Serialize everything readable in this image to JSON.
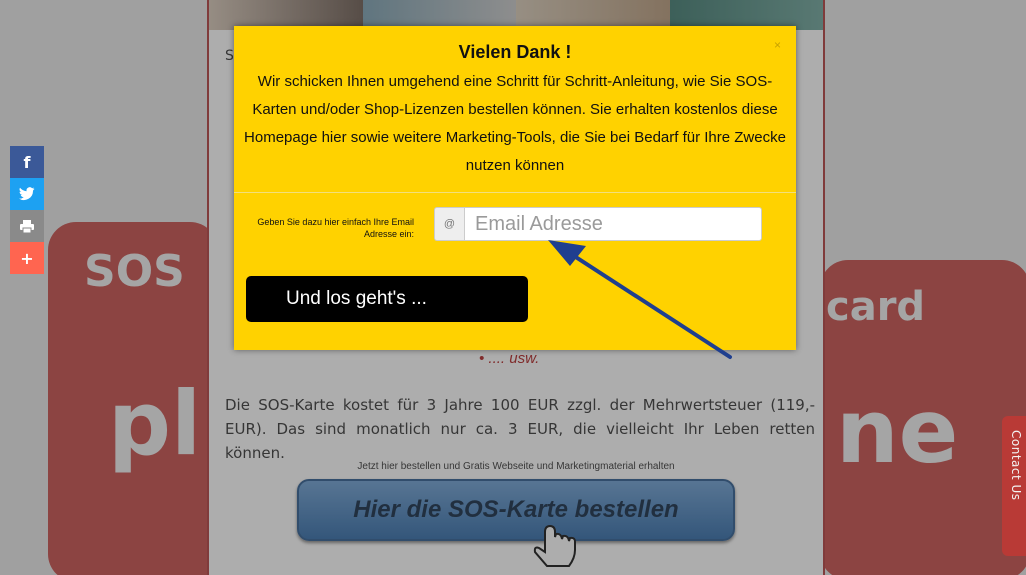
{
  "background": {
    "left_word": "SOS",
    "right_word": "card",
    "left_big": "pl",
    "right_big": "ne",
    "s_letter": "S",
    "list_tail": "• .... usw.",
    "price_paragraph": "Die SOS-Karte kostet für 3 Jahre 100 EUR zzgl. der Mehrwertsteuer (119,- EUR). Das sind monatlich nur ca. 3 EUR, die vielleicht Ihr Leben retten können.",
    "small_note": "Jetzt hier bestellen und Gratis Webseite und Marketingmaterial erhalten",
    "order_button": "Hier die SOS-Karte bestellen"
  },
  "social": {
    "facebook": "f",
    "twitter": "twitter-icon",
    "print": "print-icon",
    "more": "+"
  },
  "contact_tab": {
    "label": "Contact Us"
  },
  "modal": {
    "close": "×",
    "title": "Vielen Dank !",
    "body": "Wir schicken Ihnen umgehend eine Schritt für Schritt-Anleitung, wie Sie SOS-Karten und/oder Shop-Lizenzen bestellen können. Sie erhalten kostenlos diese Homepage hier sowie weitere Marketing-Tools, die Sie bei Bedarf für Ihre Zwecke nutzen können",
    "email_label": "Geben Sie dazu hier einfach Ihre Email Adresse ein:",
    "email_addon": "@",
    "email_placeholder": "Email Adresse",
    "email_value": "",
    "submit": "Und los geht's ..."
  },
  "colors": {
    "modal_bg": "#ffd200",
    "accent_red": "#c64a47",
    "facebook": "#3b5998",
    "twitter": "#1da1f2",
    "print": "#8a8a8a",
    "share": "#ff6550",
    "arrow": "#1f3f8f"
  }
}
